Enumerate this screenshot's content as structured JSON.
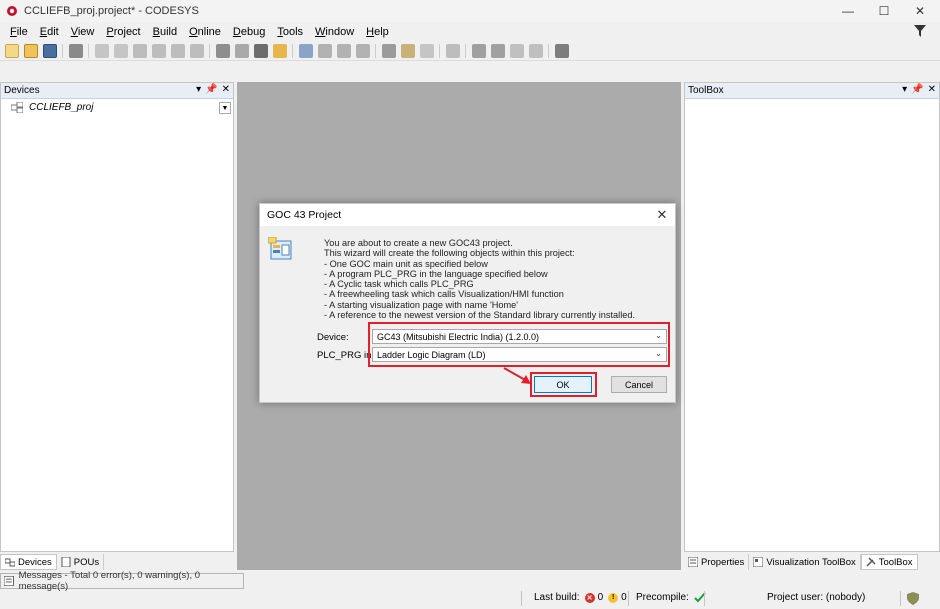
{
  "window": {
    "title": "CCLIEFB_proj.project* - CODESYS",
    "controls": [
      "—",
      "☐",
      "✕"
    ]
  },
  "menu": {
    "items": [
      {
        "label": "File",
        "underline": "F",
        "rest": "ile"
      },
      {
        "label": "Edit",
        "underline": "E",
        "rest": "dit"
      },
      {
        "label": "View",
        "underline": "V",
        "rest": "iew"
      },
      {
        "label": "Project",
        "underline": "P",
        "rest": "roject"
      },
      {
        "label": "Build",
        "underline": "B",
        "rest": "uild"
      },
      {
        "label": "Online",
        "underline": "O",
        "rest": "nline"
      },
      {
        "label": "Debug",
        "underline": "D",
        "rest": "ebug"
      },
      {
        "label": "Tools",
        "underline": "T",
        "rest": "ools"
      },
      {
        "label": "Window",
        "underline": "W",
        "rest": "indow"
      },
      {
        "label": "Help",
        "underline": "H",
        "rest": "elp"
      }
    ]
  },
  "devices_panel": {
    "title": "Devices",
    "tree_root": "CCLIEFB_proj",
    "tabs": [
      "Devices",
      "POUs"
    ]
  },
  "toolbox_panel": {
    "title": "ToolBox",
    "tabs": [
      "Properties",
      "Visualization ToolBox",
      "ToolBox"
    ]
  },
  "messages": {
    "text": "Messages - Total 0 error(s), 0 warning(s), 0 message(s)"
  },
  "statusbar": {
    "last_build_label": "Last build:",
    "errors": "0",
    "warnings": "0",
    "precompile_label": "Precompile:",
    "project_user": "Project user: (nobody)"
  },
  "dialog": {
    "title": "GOC 43 Project",
    "close": "✕",
    "message_lines": [
      "You are about to create a new GOC43 project.",
      "This wizard will create the following objects within this project:",
      "- One GOC main unit as specified below",
      "- A program PLC_PRG in the language specified below",
      "- A Cyclic task which calls PLC_PRG",
      "- A freewheeling task which calls Visualization/HMI function",
      "- A starting visualization page with name 'Home'",
      "- A reference to the newest version of the Standard library currently installed."
    ],
    "device_label": "Device:",
    "device_value": "GC43 (Mitsubishi Electric India) (1.2.0.0)",
    "language_label": "PLC_PRG in:",
    "language_value": "Ladder Logic Diagram (LD)",
    "ok_label": "OK",
    "cancel_label": "Cancel"
  },
  "colors": {
    "highlight_red": "#e0202a",
    "workspace_gray": "#ababab",
    "panel_header": "#e9eef6",
    "accent_blue": "#0078d7"
  }
}
